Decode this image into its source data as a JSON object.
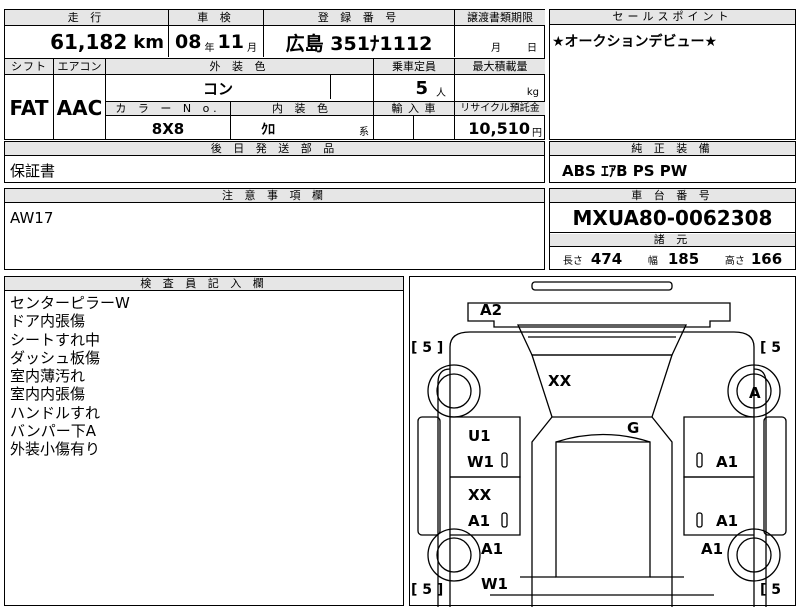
{
  "top_fields": {
    "mileage_label": "走 行",
    "mileage_value": "61,182",
    "mileage_unit": "km",
    "inspection_label": "車 検",
    "inspection_year": "08",
    "inspection_year_unit": "年",
    "inspection_month": "11",
    "inspection_month_unit": "月",
    "plate_label": "登 録 番 号",
    "plate_value": "広島 351ﾅ1112",
    "transfer_label": "譲渡書類期限",
    "transfer_month_unit": "月",
    "transfer_day_unit": "日"
  },
  "sales_point": {
    "header": "セールスポイント",
    "text": "★オークションデビュー★"
  },
  "spec_row": {
    "shift_label": "シフト",
    "shift_value": "FAT",
    "aircon_label": "エアコン",
    "aircon_value": "AAC",
    "exterior_label": "外 装 色",
    "exterior_value": "コン",
    "capacity_label": "乗車定員",
    "capacity_value": "5",
    "capacity_unit": "人",
    "load_label": "最大積載量",
    "load_unit": "kg",
    "color_no_label": "カ ラ ー N o.",
    "color_no_value": "8X8",
    "interior_label": "内 装 色",
    "interior_value": "ｸﾛ",
    "interior_unit": "系",
    "import_label": "輸 入 車",
    "recycle_label": "リサイクル預託金",
    "recycle_value": "10,510",
    "recycle_unit": "円"
  },
  "later_parts": {
    "header": "後 日 発 送 部 品",
    "text": "保証書"
  },
  "genuine_equipment": {
    "header": "純 正 装 備",
    "text": "ABS ｴｱB PS PW"
  },
  "notes": {
    "header": "注 意 事 項 欄",
    "text": "AW17"
  },
  "chassis": {
    "header": "車 台 番 号",
    "value": "MXUA80-0062308"
  },
  "dimensions": {
    "header": "諸 元",
    "length_label": "長さ",
    "length_value": "474",
    "width_label": "幅",
    "width_value": "185",
    "height_label": "高さ",
    "height_value": "166"
  },
  "inspector": {
    "header": "検 査 員 記 入 欄",
    "lines": [
      "センターピラーW",
      "ドア内張傷",
      "シートすれ中",
      "ダッシュ板傷",
      "室内薄汚れ",
      "室内内張傷",
      "ハンドルすれ",
      "バンパー下A",
      "外装小傷有り"
    ]
  },
  "diagram": {
    "marks": {
      "rear_bumper": "A2",
      "roof": "XX",
      "hood_area": "G",
      "right_rear_wheel": "A",
      "left_rear_door_upper": "U1",
      "left_rear_door": "W1",
      "left_front_door_upper": "XX",
      "left_front_door": "A1",
      "right_rear_door": "A1",
      "right_front_door": "A1",
      "left_front_fender": "A1",
      "right_front_fender": "A1",
      "front_bumper": "W1"
    },
    "tires": {
      "rear_left": "[ 5 ]",
      "rear_right": "[ 5",
      "front_left": "[ 5 ]",
      "front_right": "[ 5"
    }
  }
}
